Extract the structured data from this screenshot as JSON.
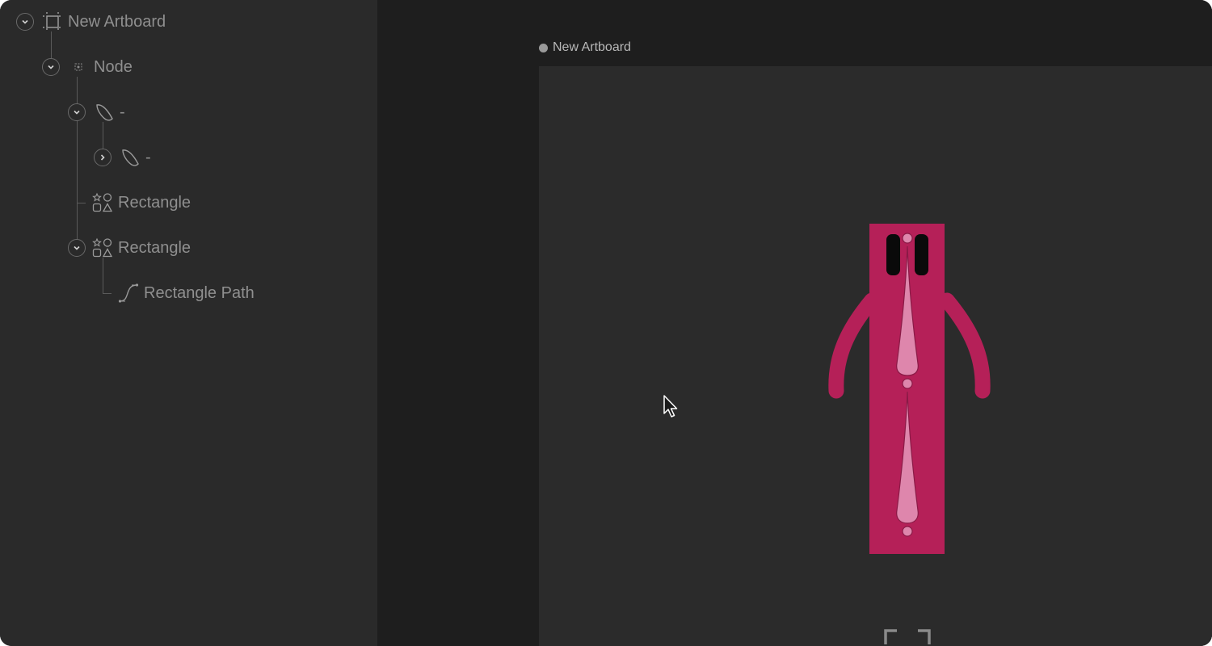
{
  "hierarchy": {
    "items": [
      {
        "label": "New Artboard",
        "icon": "artboard-icon",
        "toggle": "expanded"
      },
      {
        "label": "Node",
        "icon": "node-icon",
        "toggle": "expanded"
      },
      {
        "label": "-",
        "icon": "ellipse-shape-icon",
        "toggle": "expanded"
      },
      {
        "label": "-",
        "icon": "ellipse-shape-icon",
        "toggle": "collapsed"
      },
      {
        "label": "Rectangle",
        "icon": "shapes-icon",
        "toggle": "none"
      },
      {
        "label": "Rectangle",
        "icon": "shapes-icon",
        "toggle": "expanded"
      },
      {
        "label": "Rectangle Path",
        "icon": "path-icon",
        "toggle": "none"
      }
    ]
  },
  "stage": {
    "artboard_title": "New Artboard"
  },
  "colors": {
    "figure_body": "#b52058",
    "figure_accent": "#de86ac",
    "eyes": "#0a0a0a"
  }
}
